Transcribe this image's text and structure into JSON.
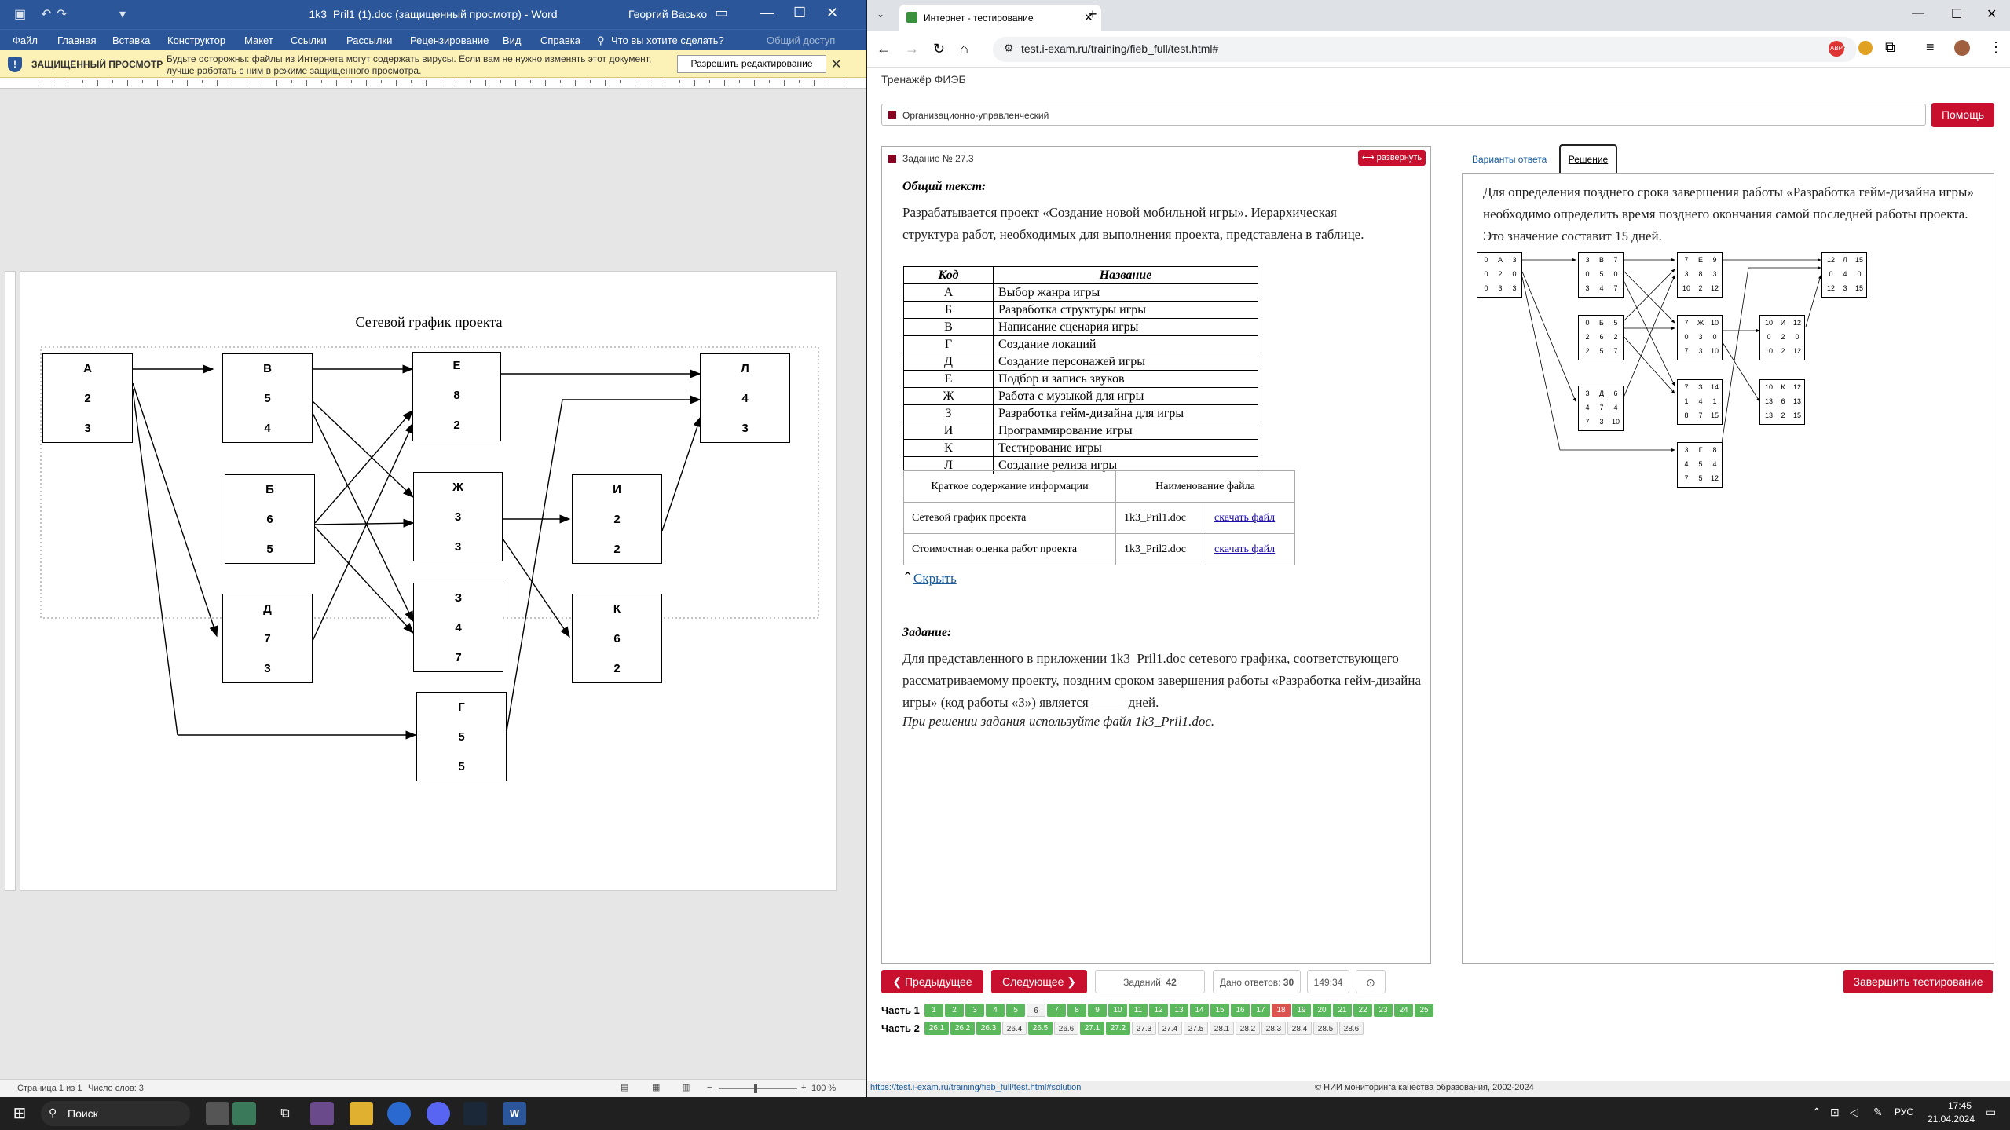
{
  "word": {
    "title": "1k3_Pril1 (1).doc (защищенный просмотр) - Word",
    "user": "Георгий Васько",
    "menu": [
      "Файл",
      "Главная",
      "Вставка",
      "Конструктор",
      "Макет",
      "Ссылки",
      "Рассылки",
      "Рецензирование",
      "Вид",
      "Справка"
    ],
    "search_tip": "Что вы хотите сделать?",
    "share": "Общий доступ",
    "protected_label": "ЗАЩИЩЕННЫЙ ПРОСМОТР",
    "protected_msg": "Будьте осторожны: файлы из Интернета могут содержать вирусы. Если вам не нужно изменять этот документ, лучше работать с ним в режиме защищенного просмотра.",
    "enable_edit": "Разрешить редактирование",
    "diagram_title": "Сетевой график проекта",
    "nodes": [
      {
        "id": "А",
        "a": "2",
        "b": "3"
      },
      {
        "id": "В",
        "a": "5",
        "b": "4"
      },
      {
        "id": "Б",
        "a": "6",
        "b": "5"
      },
      {
        "id": "Д",
        "a": "7",
        "b": "3"
      },
      {
        "id": "Е",
        "a": "8",
        "b": "2"
      },
      {
        "id": "Ж",
        "a": "3",
        "b": "3"
      },
      {
        "id": "З",
        "a": "4",
        "b": "7"
      },
      {
        "id": "Г",
        "a": "5",
        "b": "5"
      },
      {
        "id": "И",
        "a": "2",
        "b": "2"
      },
      {
        "id": "К",
        "a": "6",
        "b": "2"
      },
      {
        "id": "Л",
        "a": "4",
        "b": "3"
      }
    ],
    "status_page": "Страница 1 из 1",
    "status_words": "Число слов: 3",
    "zoom": "100 %"
  },
  "chrome": {
    "tab_title": "Интернет - тестирование",
    "url": "test.i-exam.ru/training/fieb_full/test.html#",
    "status_url": "https://test.i-exam.ru/training/fieb_full/test.html#solution",
    "copyright": "© НИИ мониторинга качества образования, 2002-2024"
  },
  "site": {
    "header": "Тренажёр ФИЭБ",
    "section": "Организационно-управленческий",
    "help": "Помощь",
    "task_label": "Задание № 27.3",
    "expand": "⟷ развернуть",
    "tab_variants": "Варианты ответа",
    "tab_solution": "Решение",
    "common_text_label": "Общий текст:",
    "intro": "Разрабатывается проект «Создание новой мобильной игры». Иерархическая структура работ, необходимых для выполнения проекта, представлена в таблице.",
    "table_head": [
      "Код",
      "Название"
    ],
    "table_rows": [
      [
        "А",
        "Выбор жанра игры"
      ],
      [
        "Б",
        "Разработка структуры игры"
      ],
      [
        "В",
        "Написание сценария игры"
      ],
      [
        "Г",
        "Создание локаций"
      ],
      [
        "Д",
        "Создание персонажей игры"
      ],
      [
        "Е",
        "Подбор и запись звуков"
      ],
      [
        "Ж",
        "Работа с музыкой для игры"
      ],
      [
        "З",
        "Разработка гейм-дизайна для игры"
      ],
      [
        "И",
        "Программирование игры"
      ],
      [
        "К",
        "Тестирование игры"
      ],
      [
        "Л",
        "Создание релиза игры"
      ]
    ],
    "files_head": [
      "Краткое содержание информации",
      "Наименование файла"
    ],
    "files": [
      [
        "Сетевой график проекта",
        "1k3_Pril1.doc",
        "скачать файл"
      ],
      [
        "Стоимостная оценка работ проекта",
        "1k3_Pril2.doc",
        "скачать файл"
      ]
    ],
    "hide": "Скрыть",
    "task_heading": "Задание:",
    "task_text": "Для представленного в приложении 1k3_Pril1.doc сетевого графика, соответствующего рассматриваемому проекту, поздним сроком завершения работы «Разработка гейм-дизайна игры» (код работы «З») является _____ дней.",
    "task_note": "При решении задания используйте файл 1k3_Pril1.doc.",
    "solution_text": "Для определения позднего срока завершения работы «Разработка гейм-дизайна игры» необходимо определить время позднего окончания самой последней работы проекта. Это значение составит 15 дней.",
    "sol_nodes": [
      [
        "0",
        "А",
        "3",
        "0",
        "2",
        "0",
        "0",
        "3",
        "3"
      ],
      [
        "3",
        "В",
        "7",
        "0",
        "5",
        "0",
        "3",
        "4",
        "7"
      ],
      [
        "0",
        "Б",
        "5",
        "2",
        "6",
        "2",
        "2",
        "5",
        "7"
      ],
      [
        "3",
        "Д",
        "6",
        "4",
        "7",
        "4",
        "7",
        "3",
        "10"
      ],
      [
        "7",
        "Е",
        "9",
        "3",
        "8",
        "3",
        "10",
        "2",
        "12"
      ],
      [
        "7",
        "Ж",
        "10",
        "0",
        "3",
        "0",
        "7",
        "3",
        "10"
      ],
      [
        "7",
        "З",
        "14",
        "1",
        "4",
        "1",
        "8",
        "7",
        "15"
      ],
      [
        "3",
        "Г",
        "8",
        "4",
        "5",
        "4",
        "7",
        "5",
        "12"
      ],
      [
        "10",
        "И",
        "12",
        "0",
        "2",
        "0",
        "10",
        "2",
        "12"
      ],
      [
        "10",
        "К",
        "12",
        "13",
        "6",
        "13",
        "13",
        "2",
        "15"
      ],
      [
        "12",
        "Л",
        "15",
        "0",
        "4",
        "0",
        "12",
        "3",
        "15"
      ]
    ],
    "prev": "Предыдущее",
    "next": "Следующее",
    "tasks_label": "Заданий:",
    "tasks_count": "42",
    "answered_label": "Дано ответов:",
    "answered_count": "30",
    "timer": "149:34",
    "finish": "Завершить тестирование",
    "part1_label": "Часть 1",
    "part2_label": "Часть 2",
    "part1": [
      {
        "n": "1",
        "s": "g"
      },
      {
        "n": "2",
        "s": "g"
      },
      {
        "n": "3",
        "s": "g"
      },
      {
        "n": "4",
        "s": "g"
      },
      {
        "n": "5",
        "s": "g"
      },
      {
        "n": "6",
        "s": "w"
      },
      {
        "n": "7",
        "s": "g"
      },
      {
        "n": "8",
        "s": "g"
      },
      {
        "n": "9",
        "s": "g"
      },
      {
        "n": "10",
        "s": "g"
      },
      {
        "n": "11",
        "s": "g"
      },
      {
        "n": "12",
        "s": "g"
      },
      {
        "n": "13",
        "s": "g"
      },
      {
        "n": "14",
        "s": "g"
      },
      {
        "n": "15",
        "s": "g"
      },
      {
        "n": "16",
        "s": "g"
      },
      {
        "n": "17",
        "s": "g"
      },
      {
        "n": "18",
        "s": "r"
      },
      {
        "n": "19",
        "s": "g"
      },
      {
        "n": "20",
        "s": "g"
      },
      {
        "n": "21",
        "s": "g"
      },
      {
        "n": "22",
        "s": "g"
      },
      {
        "n": "23",
        "s": "g"
      },
      {
        "n": "24",
        "s": "g"
      },
      {
        "n": "25",
        "s": "g"
      }
    ],
    "part2": [
      {
        "n": "26.1",
        "s": "g"
      },
      {
        "n": "26.2",
        "s": "g"
      },
      {
        "n": "26.3",
        "s": "g"
      },
      {
        "n": "26.4",
        "s": "w"
      },
      {
        "n": "26.5",
        "s": "g"
      },
      {
        "n": "26.6",
        "s": "w"
      },
      {
        "n": "27.1",
        "s": "g"
      },
      {
        "n": "27.2",
        "s": "g"
      },
      {
        "n": "27.3",
        "s": "w"
      },
      {
        "n": "27.4",
        "s": "w"
      },
      {
        "n": "27.5",
        "s": "w"
      },
      {
        "n": "28.1",
        "s": "w"
      },
      {
        "n": "28.2",
        "s": "w"
      },
      {
        "n": "28.3",
        "s": "w"
      },
      {
        "n": "28.4",
        "s": "w"
      },
      {
        "n": "28.5",
        "s": "w"
      },
      {
        "n": "28.6",
        "s": "w"
      }
    ]
  },
  "taskbar": {
    "search": "Поиск",
    "lang": "РУС",
    "time": "17:45",
    "date": "21.04.2024"
  },
  "colors": {
    "word_blue": "#2b579a",
    "site_red": "#c8102e",
    "cell_green": "#5cb85c",
    "cell_red": "#d9534f"
  }
}
